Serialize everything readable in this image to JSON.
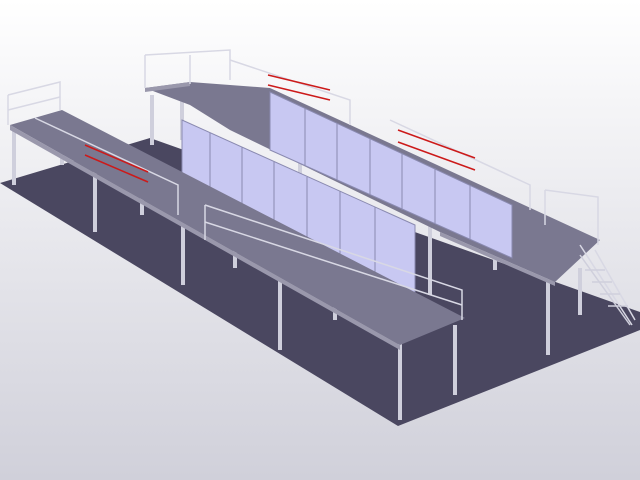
{
  "scene": {
    "description_label": "",
    "colors": {
      "background_top": "#ffffff",
      "background_bottom": "#d0d0da",
      "floor": "#4a4760",
      "deck": "#7a7890",
      "deck_edge": "#9a98ac",
      "panel": "#c8c8f2",
      "panel_edge": "#8a8ab0",
      "rail": "#d8d8e4",
      "highlight_rail": "#cc1a1a",
      "post": "#cfcfdc"
    }
  }
}
